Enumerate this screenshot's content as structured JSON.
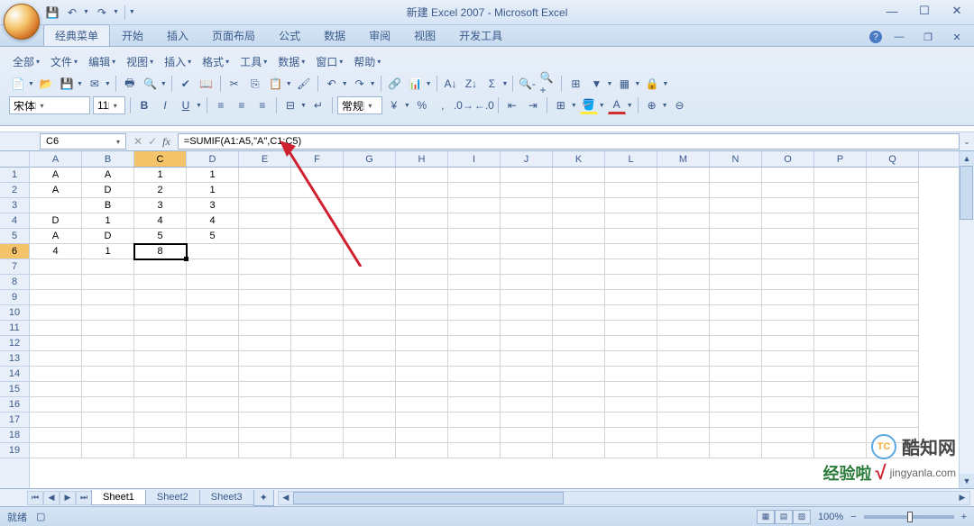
{
  "app": {
    "title": "新建 Excel 2007 - Microsoft Excel"
  },
  "qat": {
    "save": "💾",
    "undo": "↶",
    "redo": "↷"
  },
  "win": {
    "min": "—",
    "max": "☐",
    "close": "✕"
  },
  "ribbon": {
    "tabs": [
      "经典菜单",
      "开始",
      "插入",
      "页面布局",
      "公式",
      "数据",
      "审阅",
      "视图",
      "开发工具"
    ],
    "active": 0
  },
  "classic_menus": [
    "全部",
    "文件",
    "编辑",
    "视图",
    "插入",
    "格式",
    "工具",
    "数据",
    "窗口",
    "帮助"
  ],
  "font": {
    "name": "宋体",
    "size": "11",
    "number_format": "常规"
  },
  "formula_bar": {
    "cell_ref": "C6",
    "formula": "=SUMIF(A1:A5,\"A\",C1:C5)"
  },
  "columns": [
    "A",
    "B",
    "C",
    "D",
    "E",
    "F",
    "G",
    "H",
    "I",
    "J",
    "K",
    "L",
    "M",
    "N",
    "O",
    "P",
    "Q"
  ],
  "rows": [
    1,
    2,
    3,
    4,
    5,
    6,
    7,
    8,
    9,
    10,
    11,
    12,
    13,
    14,
    15,
    16,
    17,
    18,
    19
  ],
  "active_col": 2,
  "active_row_idx": 5,
  "cells": {
    "r0": [
      "A",
      "A",
      "1",
      "1",
      "",
      "",
      "",
      "",
      "",
      "",
      "",
      "",
      "",
      "",
      "",
      "",
      ""
    ],
    "r1": [
      "A",
      "D",
      "2",
      "1",
      "",
      "",
      "",
      "",
      "",
      "",
      "",
      "",
      "",
      "",
      "",
      "",
      ""
    ],
    "r2": [
      "",
      "B",
      "3",
      "3",
      "",
      "",
      "",
      "",
      "",
      "",
      "",
      "",
      "",
      "",
      "",
      "",
      ""
    ],
    "r3": [
      "D",
      "1",
      "4",
      "4",
      "",
      "",
      "",
      "",
      "",
      "",
      "",
      "",
      "",
      "",
      "",
      "",
      ""
    ],
    "r4": [
      "A",
      "D",
      "5",
      "5",
      "",
      "",
      "",
      "",
      "",
      "",
      "",
      "",
      "",
      "",
      "",
      "",
      ""
    ],
    "r5": [
      "4",
      "1",
      "8",
      "",
      "",
      "",
      "",
      "",
      "",
      "",
      "",
      "",
      "",
      "",
      "",
      "",
      ""
    ]
  },
  "sheets": {
    "tabs": [
      "Sheet1",
      "Sheet2",
      "Sheet3"
    ],
    "active": 0
  },
  "status": {
    "ready": "就绪",
    "zoom": "100%",
    "zoom_minus": "−",
    "zoom_plus": "+"
  },
  "watermarks": {
    "w1_logo": "TC",
    "w1_text": "酷知网",
    "w2_text": "经验啦",
    "w2_check": "√",
    "w2_url": "jingyanla.com"
  },
  "chart_data": {
    "type": "table",
    "title": "Spreadsheet data A1:D6",
    "columns": [
      "A",
      "B",
      "C",
      "D"
    ],
    "rows": [
      [
        "A",
        "A",
        1,
        1
      ],
      [
        "A",
        "D",
        2,
        1
      ],
      [
        "",
        "B",
        3,
        3
      ],
      [
        "D",
        1,
        4,
        4
      ],
      [
        "A",
        "D",
        5,
        5
      ],
      [
        4,
        1,
        8,
        null
      ]
    ],
    "active_cell": "C6",
    "formula_in_active_cell": "=SUMIF(A1:A5,\"A\",C1:C5)",
    "formula_result": 8
  }
}
